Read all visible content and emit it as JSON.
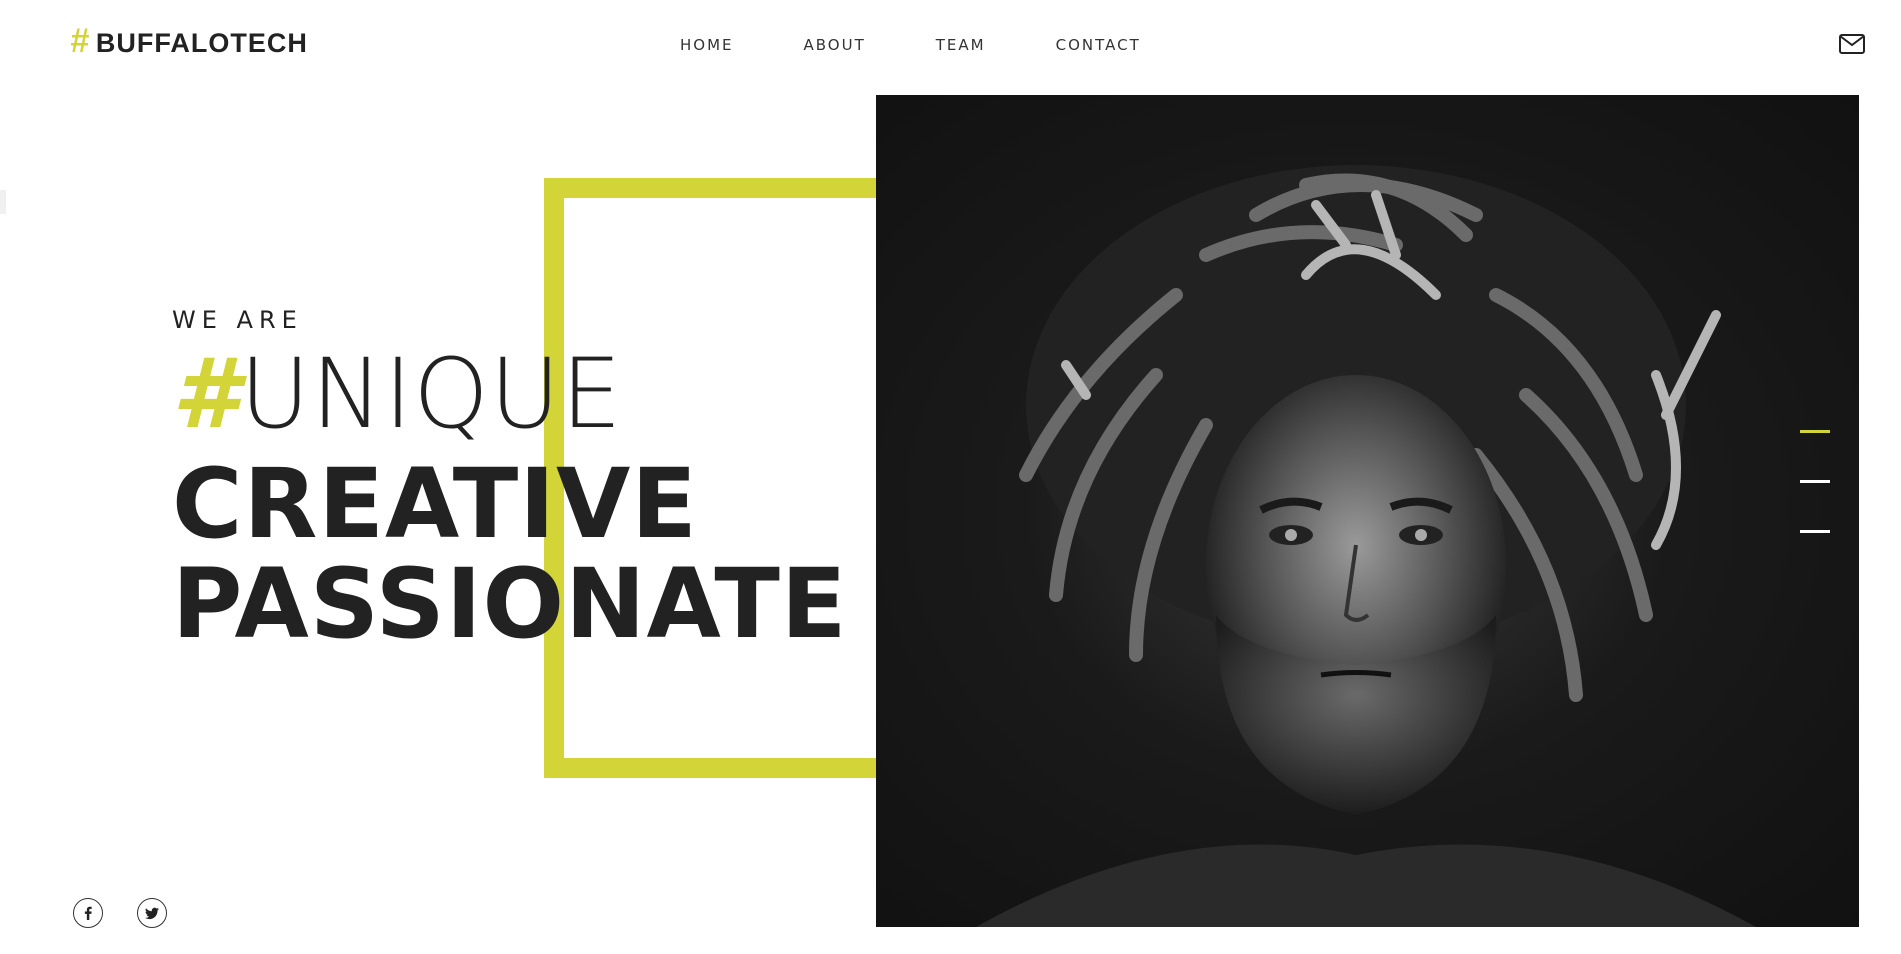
{
  "brand": {
    "hash": "#",
    "name": "BUFFALOTECH"
  },
  "nav": {
    "items": [
      {
        "label": "HOME"
      },
      {
        "label": "ABOUT"
      },
      {
        "label": "TEAM"
      },
      {
        "label": "CONTACT"
      }
    ]
  },
  "hero": {
    "intro": "WE ARE",
    "hash": "#",
    "line1": "UNIQUE",
    "line2": "CREATIVE",
    "line3": "PASSIONATE"
  },
  "slider": {
    "count": 3,
    "active_index": 0
  },
  "icons": {
    "mail": "mail-icon",
    "facebook": "facebook-icon",
    "twitter": "twitter-icon"
  },
  "colors": {
    "accent": "#d2d438",
    "text": "#222222",
    "photo_bg": "#1a1a1a"
  }
}
